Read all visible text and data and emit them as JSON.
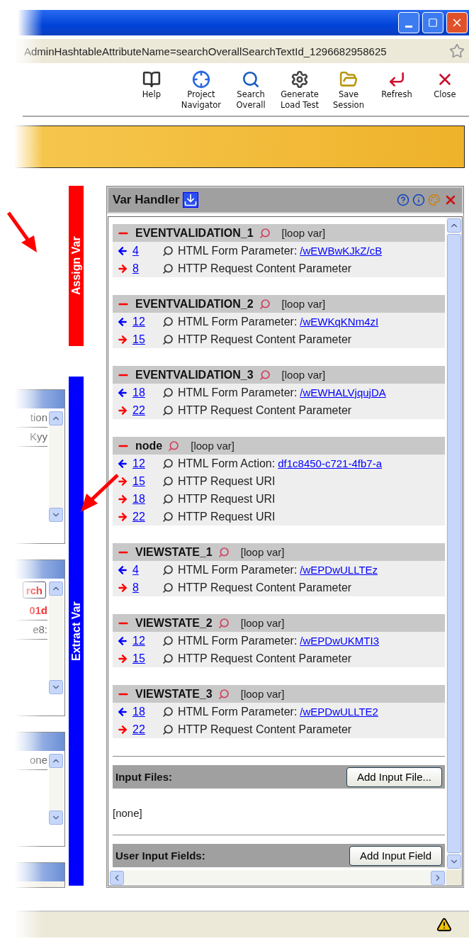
{
  "window": {
    "address": "AdminHashtableAttributeName=searchOverallSearchTextId_1296682958625"
  },
  "toolbar": [
    {
      "kind": "help",
      "lines": [
        "Help"
      ]
    },
    {
      "kind": "navigator",
      "lines": [
        "Project",
        "Navigator"
      ]
    },
    {
      "kind": "search",
      "lines": [
        "Search",
        "Overall"
      ]
    },
    {
      "kind": "generate",
      "lines": [
        "Generate",
        "Load Test"
      ]
    },
    {
      "kind": "save",
      "lines": [
        "Save",
        "Session"
      ]
    },
    {
      "kind": "refresh",
      "lines": [
        "Refresh"
      ]
    },
    {
      "kind": "close",
      "lines": [
        "Close"
      ]
    }
  ],
  "side_tabs": [
    {
      "label": "Assign Var",
      "color": "#ff0000"
    },
    {
      "label": "Extract Var",
      "color": "#0000ff"
    }
  ],
  "left_panels": [
    {
      "rows": [
        "tion",
        "Kyy"
      ]
    },
    {
      "button": "rch",
      "rows": [
        "01d",
        "e8:"
      ]
    },
    {
      "rows": [
        "one"
      ]
    }
  ],
  "var_handler": {
    "title": "Var Handler",
    "groups": [
      {
        "name": "EVENTVALIDATION_1",
        "tag": "[loop var]",
        "rows": [
          {
            "kind": "in",
            "line": "4",
            "label": "HTML Form Parameter:",
            "value": "/wEWBwKJkZ/cB"
          },
          {
            "kind": "out",
            "line": "8",
            "label": "HTTP Request Content Parameter"
          }
        ]
      },
      {
        "name": "EVENTVALIDATION_2",
        "tag": "[loop var]",
        "rows": [
          {
            "kind": "in",
            "line": "12",
            "label": "HTML Form Parameter:",
            "value": "/wEWKqKNm4zI"
          },
          {
            "kind": "out",
            "line": "15",
            "label": "HTTP Request Content Parameter"
          }
        ]
      },
      {
        "name": "EVENTVALIDATION_3",
        "tag": "[loop var]",
        "rows": [
          {
            "kind": "in",
            "line": "18",
            "label": "HTML Form Parameter:",
            "value": "/wEWHALVjqujDA"
          },
          {
            "kind": "out",
            "line": "22",
            "label": "HTTP Request Content Parameter"
          }
        ]
      },
      {
        "name": "node",
        "tag": "[loop var]",
        "rows": [
          {
            "kind": "in",
            "line": "12",
            "label": "HTML Form Action:",
            "value": "df1c8450-c721-4fb7-a"
          },
          {
            "kind": "out",
            "line": "15",
            "label": "HTTP Request URI"
          },
          {
            "kind": "out",
            "line": "18",
            "label": "HTTP Request URI"
          },
          {
            "kind": "out",
            "line": "22",
            "label": "HTTP Request URI"
          }
        ]
      },
      {
        "name": "VIEWSTATE_1",
        "tag": "[loop var]",
        "rows": [
          {
            "kind": "in",
            "line": "4",
            "label": "HTML Form Parameter:",
            "value": "/wEPDwULLTEz"
          },
          {
            "kind": "out",
            "line": "8",
            "label": "HTTP Request Content Parameter"
          }
        ]
      },
      {
        "name": "VIEWSTATE_2",
        "tag": "[loop var]",
        "rows": [
          {
            "kind": "in",
            "line": "12",
            "label": "HTML Form Parameter:",
            "value": "/wEPDwUKMTI3"
          },
          {
            "kind": "out",
            "line": "15",
            "label": "HTTP Request Content Parameter"
          }
        ]
      },
      {
        "name": "VIEWSTATE_3",
        "tag": "[loop var]",
        "rows": [
          {
            "kind": "in",
            "line": "18",
            "label": "HTML Form Parameter:",
            "value": "/wEPDwULLTE2"
          },
          {
            "kind": "out",
            "line": "22",
            "label": "HTTP Request Content Parameter"
          }
        ]
      }
    ],
    "input_files": {
      "title": "Input Files:",
      "button": "Add Input File...",
      "value": "[none]"
    },
    "user_input_fields": {
      "title": "User Input Fields:",
      "button": "Add Input Field"
    }
  }
}
